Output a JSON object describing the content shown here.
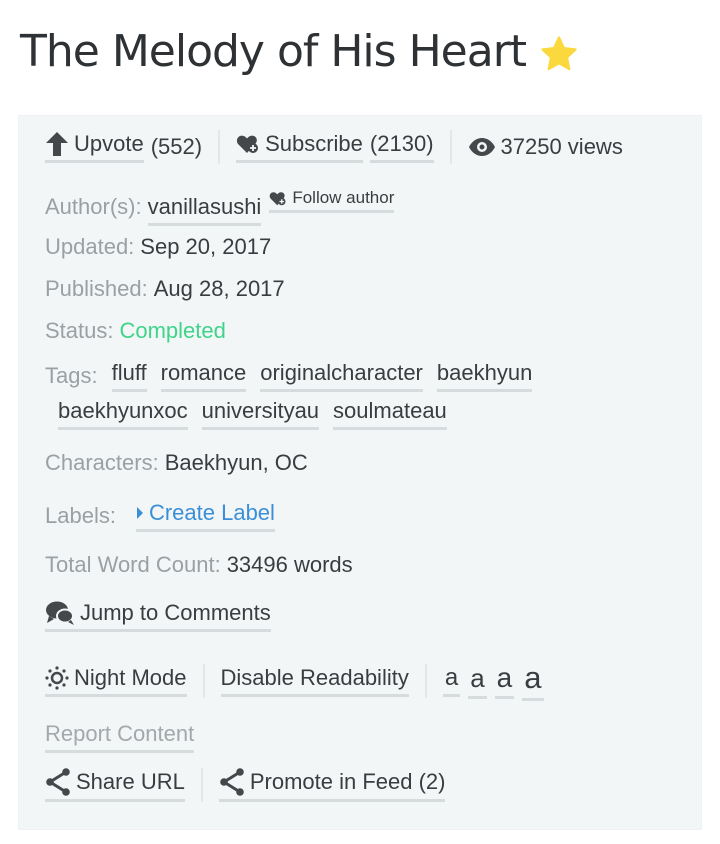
{
  "title": "The Melody of His Heart",
  "title_icon": "star-icon",
  "colors": {
    "panel_bg": "#f3f6f7",
    "status_completed": "#3fd48a",
    "create_label": "#3b8fd6",
    "star": "#fbd93e"
  },
  "actions": {
    "upvote": {
      "icon": "arrow-up-icon",
      "label": "Upvote",
      "count": "(552)"
    },
    "subscribe": {
      "icon": "heart-plus-icon",
      "label": "Subscribe",
      "count": "(2130)"
    },
    "views": {
      "icon": "eye-icon",
      "label": "37250 views"
    }
  },
  "author": {
    "label": "Author(s):",
    "name": "vanillasushi",
    "follow_icon": "heart-plus-icon",
    "follow_label": "Follow author"
  },
  "updated": {
    "label": "Updated:",
    "value": "Sep 20, 2017"
  },
  "published": {
    "label": "Published:",
    "value": "Aug 28, 2017"
  },
  "status": {
    "label": "Status:",
    "value": "Completed"
  },
  "tags": {
    "label": "Tags:",
    "items": [
      "fluff",
      "romance",
      "originalcharacter",
      "baekhyun",
      "baekhyunxoc",
      "universityau",
      "soulmateau"
    ]
  },
  "characters": {
    "label": "Characters:",
    "value": "Baekhyun, OC"
  },
  "labels": {
    "label": "Labels:",
    "icon": "caret-right-icon",
    "create_label": "Create Label"
  },
  "word_count": {
    "label": "Total Word Count:",
    "value": "33496 words"
  },
  "comments": {
    "icon": "comments-icon",
    "label": "Jump to Comments"
  },
  "reading": {
    "night_mode_icon": "sun-icon",
    "night_mode": "Night Mode",
    "disable_readability": "Disable Readability",
    "font_sizes": [
      "a",
      "a",
      "a",
      "a"
    ]
  },
  "report": "Report Content",
  "share": {
    "icon": "share-icon",
    "share_url": "Share URL",
    "promote": "Promote in Feed (2)"
  }
}
